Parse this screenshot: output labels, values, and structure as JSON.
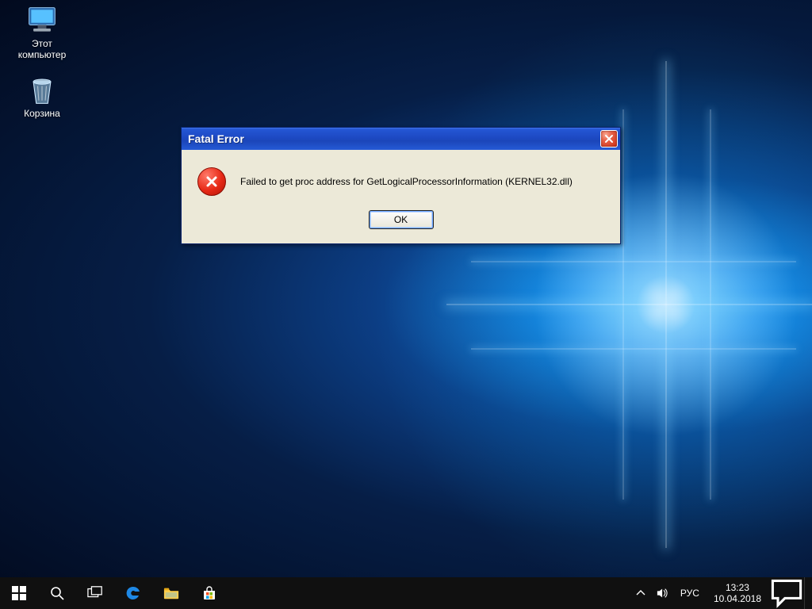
{
  "desktop": {
    "icons": [
      {
        "name": "this-pc",
        "label": "Этот\nкомпьютер"
      },
      {
        "name": "recycle-bin",
        "label": "Корзина"
      }
    ]
  },
  "dialog": {
    "title": "Fatal Error",
    "message": "Failed to get proc address for GetLogicalProcessorInformation (KERNEL32.dll)",
    "ok_label": "OK"
  },
  "taskbar": {
    "language": "РУС",
    "time": "13:23",
    "date": "10.04.2018"
  }
}
